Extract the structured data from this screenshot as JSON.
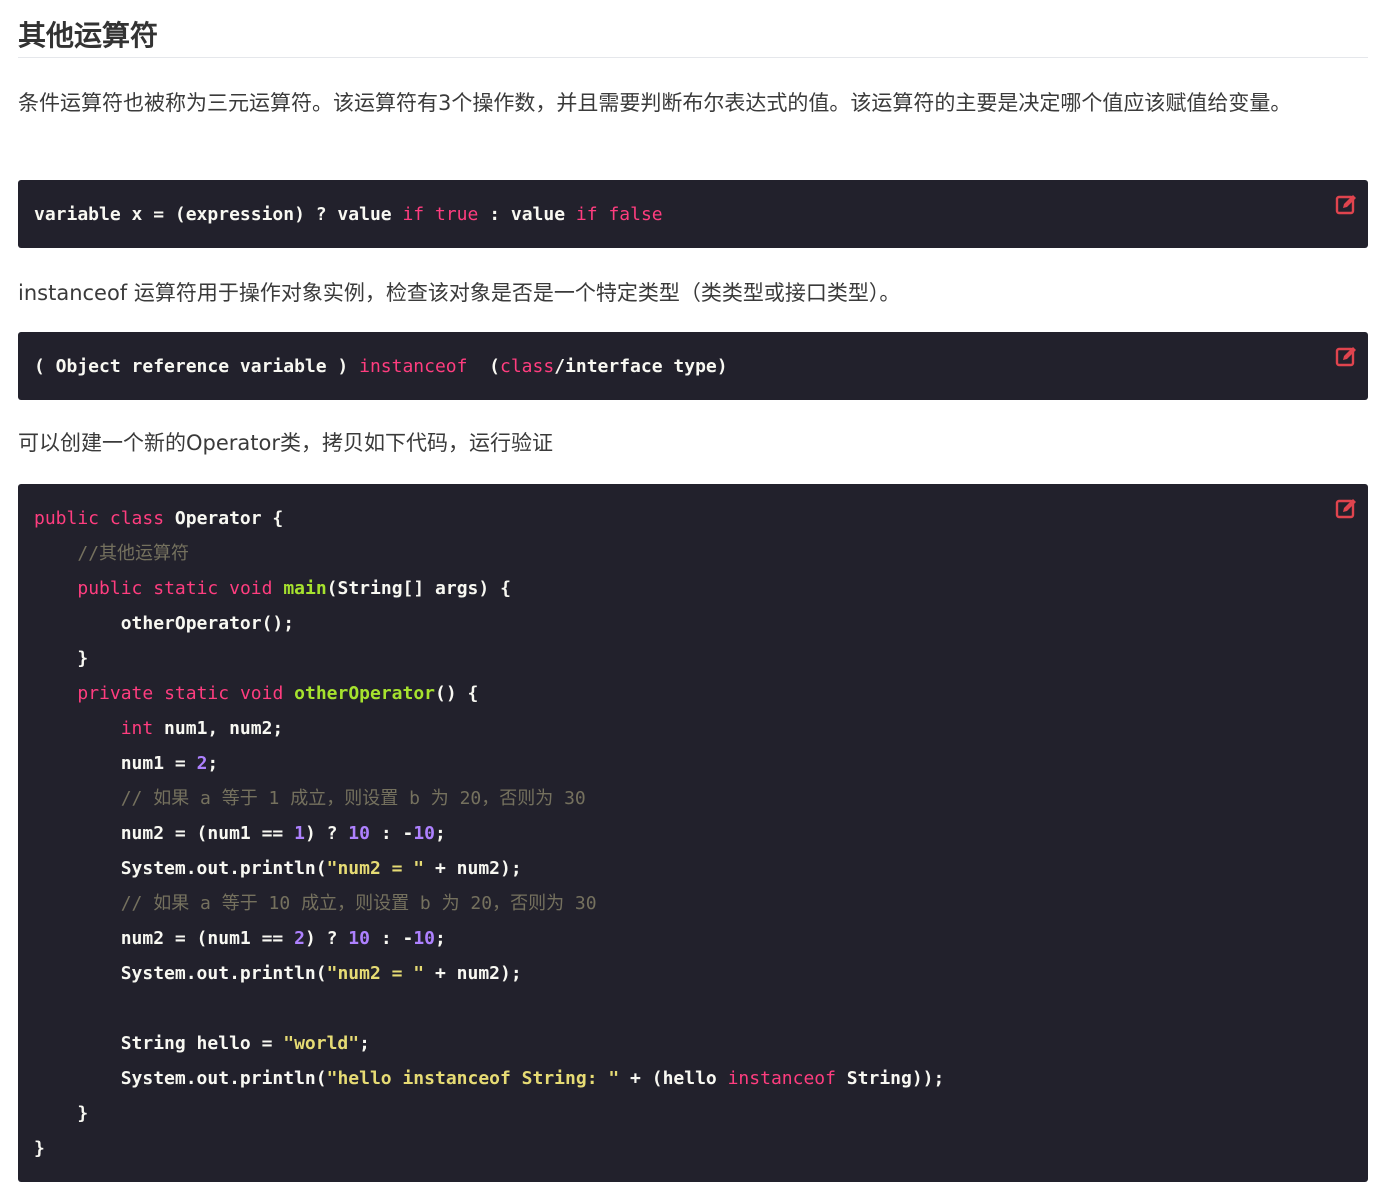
{
  "heading": "其他运算符",
  "paragraphs": {
    "intro": "条件运算符也被称为三元运算符。该运算符有3个操作数，并且需要判断布尔表达式的值。该运算符的主要是决定哪个值应该赋值给变量。",
    "instanceof": "instanceof 运算符用于操作对象实例，检查该对象是否是一个特定类型（类类型或接口类型）。",
    "create": "可以创建一个新的Operator类，拷贝如下代码，运行验证"
  },
  "icons": {
    "edit": "edit-icon"
  },
  "colors": {
    "code_bg": "#22212c",
    "keyword": "#ff3d7f",
    "function": "#a6e22e",
    "string": "#e6db74",
    "number": "#ae81ff",
    "comment": "#75715e",
    "edit_icon": "#e0444e"
  },
  "code_blocks": [
    {
      "lines": [
        [
          [
            "t",
            "variable x = (expression) ? value "
          ],
          [
            "k",
            "if"
          ],
          [
            "t",
            " "
          ],
          [
            "k",
            "true"
          ],
          [
            "t",
            " : value "
          ],
          [
            "k",
            "if"
          ],
          [
            "t",
            " "
          ],
          [
            "k",
            "false"
          ]
        ]
      ]
    },
    {
      "lines": [
        [
          [
            "t",
            "( Object reference variable ) "
          ],
          [
            "k",
            "instanceof"
          ],
          [
            "t",
            "  ("
          ],
          [
            "k",
            "class"
          ],
          [
            "t",
            "/interface type)"
          ]
        ]
      ]
    },
    {
      "lines": [
        [
          [
            "k",
            "public"
          ],
          [
            "t",
            " "
          ],
          [
            "k",
            "class"
          ],
          [
            "t",
            " Operator {"
          ]
        ],
        [
          [
            "t",
            "    "
          ],
          [
            "c",
            "//其他运算符"
          ]
        ],
        [
          [
            "t",
            "    "
          ],
          [
            "k",
            "public"
          ],
          [
            "t",
            " "
          ],
          [
            "k",
            "static"
          ],
          [
            "t",
            " "
          ],
          [
            "k",
            "void"
          ],
          [
            "t",
            " "
          ],
          [
            "fn",
            "main"
          ],
          [
            "t",
            "(String[] args) {"
          ]
        ],
        [
          [
            "t",
            "        otherOperator();"
          ]
        ],
        [
          [
            "t",
            "    }"
          ]
        ],
        [
          [
            "t",
            "    "
          ],
          [
            "k",
            "private"
          ],
          [
            "t",
            " "
          ],
          [
            "k",
            "static"
          ],
          [
            "t",
            " "
          ],
          [
            "k",
            "void"
          ],
          [
            "t",
            " "
          ],
          [
            "fn",
            "otherOperator"
          ],
          [
            "t",
            "() {"
          ]
        ],
        [
          [
            "t",
            "        "
          ],
          [
            "k",
            "int"
          ],
          [
            "t",
            " num1, num2;"
          ]
        ],
        [
          [
            "t",
            "        num1 = "
          ],
          [
            "n",
            "2"
          ],
          [
            "t",
            ";"
          ]
        ],
        [
          [
            "t",
            "        "
          ],
          [
            "c",
            "// 如果 a 等于 1 成立，则设置 b 为 20，否则为 30"
          ]
        ],
        [
          [
            "t",
            "        num2 = (num1 == "
          ],
          [
            "n",
            "1"
          ],
          [
            "t",
            ") ? "
          ],
          [
            "n",
            "10"
          ],
          [
            "t",
            " : -"
          ],
          [
            "n",
            "10"
          ],
          [
            "t",
            ";"
          ]
        ],
        [
          [
            "t",
            "        System.out.println("
          ],
          [
            "s",
            "\"num2 = \""
          ],
          [
            "t",
            " + num2);"
          ]
        ],
        [
          [
            "t",
            "        "
          ],
          [
            "c",
            "// 如果 a 等于 10 成立，则设置 b 为 20，否则为 30"
          ]
        ],
        [
          [
            "t",
            "        num2 = (num1 == "
          ],
          [
            "n",
            "2"
          ],
          [
            "t",
            ") ? "
          ],
          [
            "n",
            "10"
          ],
          [
            "t",
            " : -"
          ],
          [
            "n",
            "10"
          ],
          [
            "t",
            ";"
          ]
        ],
        [
          [
            "t",
            "        System.out.println("
          ],
          [
            "s",
            "\"num2 = \""
          ],
          [
            "t",
            " + num2);"
          ]
        ],
        [
          [
            "t",
            ""
          ]
        ],
        [
          [
            "t",
            "        String hello = "
          ],
          [
            "s",
            "\"world\""
          ],
          [
            "t",
            ";"
          ]
        ],
        [
          [
            "t",
            "        System.out.println("
          ],
          [
            "s",
            "\"hello instanceof String: \""
          ],
          [
            "t",
            " + (hello "
          ],
          [
            "k",
            "instanceof"
          ],
          [
            "t",
            " String));"
          ]
        ],
        [
          [
            "t",
            "    }"
          ]
        ],
        [
          [
            "t",
            "}"
          ]
        ]
      ]
    }
  ]
}
